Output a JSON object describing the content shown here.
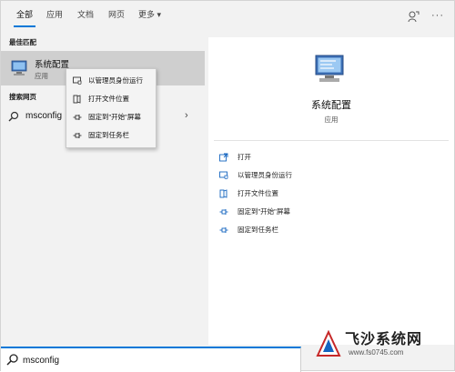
{
  "tabs": [
    {
      "label": "全部"
    },
    {
      "label": "应用"
    },
    {
      "label": "文档"
    },
    {
      "label": "网页"
    },
    {
      "label": "更多 ▾"
    }
  ],
  "left": {
    "best_match_label": "最佳匹配",
    "best_match": {
      "title": "系统配置",
      "subtitle": "应用"
    },
    "web_label": "搜索网页",
    "web_result": "msconfig"
  },
  "context_menu": [
    {
      "label": "以管理员身份运行",
      "icon": "admin-shield-icon"
    },
    {
      "label": "打开文件位置",
      "icon": "file-location-icon"
    },
    {
      "label": "固定到\"开始\"屏幕",
      "icon": "pin-icon"
    },
    {
      "label": "固定到任务栏",
      "icon": "pin-icon"
    }
  ],
  "preview": {
    "title": "系统配置",
    "subtitle": "应用",
    "actions": [
      {
        "label": "打开",
        "icon": "open-icon"
      },
      {
        "label": "以管理员身份运行",
        "icon": "admin-shield-icon"
      },
      {
        "label": "打开文件位置",
        "icon": "file-location-icon"
      },
      {
        "label": "固定到\"开始\"屏幕",
        "icon": "pin-icon"
      },
      {
        "label": "固定到任务栏",
        "icon": "pin-icon"
      }
    ]
  },
  "search": {
    "value": "msconfig"
  },
  "watermark": {
    "name": "飞沙系统网",
    "url": "www.fs0745.com"
  },
  "colors": {
    "accent": "#0078d7",
    "selected_row": "#cfcfcf",
    "panel": "#f2f2f2"
  }
}
